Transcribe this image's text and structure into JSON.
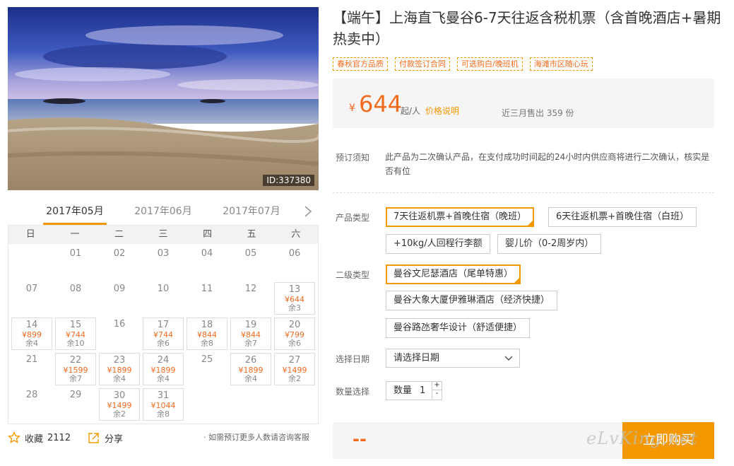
{
  "hero": {
    "id_label": "ID:337380"
  },
  "calendar": {
    "months": [
      "2017年05月",
      "2017年06月",
      "2017年07月"
    ],
    "weekdays": [
      "日",
      "一",
      "二",
      "三",
      "四",
      "五",
      "六"
    ],
    "rows": [
      [
        null,
        {
          "d": "01"
        },
        {
          "d": "02"
        },
        {
          "d": "03"
        },
        {
          "d": "04"
        },
        {
          "d": "05"
        },
        {
          "d": "06"
        }
      ],
      [
        {
          "d": "07"
        },
        {
          "d": "08"
        },
        {
          "d": "09"
        },
        {
          "d": "10"
        },
        {
          "d": "11"
        },
        {
          "d": "12"
        },
        {
          "d": "13",
          "p": "¥644",
          "r": "余3"
        }
      ],
      [
        {
          "d": "14",
          "p": "¥899",
          "r": "余4"
        },
        {
          "d": "15",
          "p": "¥744",
          "r": "余10"
        },
        {
          "d": "16"
        },
        {
          "d": "17",
          "p": "¥744",
          "r": "余6"
        },
        {
          "d": "18",
          "p": "¥844",
          "r": "余8"
        },
        {
          "d": "19",
          "p": "¥844",
          "r": "余7"
        },
        {
          "d": "20",
          "p": "¥799",
          "r": "余6"
        }
      ],
      [
        {
          "d": "21"
        },
        {
          "d": "22",
          "p": "¥1599",
          "r": "余7"
        },
        {
          "d": "23",
          "p": "¥1899",
          "r": "余4"
        },
        {
          "d": "24",
          "p": "¥1899",
          "r": "余4"
        },
        {
          "d": "25"
        },
        {
          "d": "26",
          "p": "¥1899",
          "r": "余4"
        },
        {
          "d": "27",
          "p": "¥1499",
          "r": "余2"
        }
      ],
      [
        {
          "d": "28"
        },
        {
          "d": "29"
        },
        {
          "d": "30",
          "p": "¥1499",
          "r": "余2"
        },
        {
          "d": "31",
          "p": "¥1044",
          "r": "余8"
        },
        null,
        null,
        null
      ]
    ]
  },
  "footer": {
    "fav_label": "收藏",
    "fav_count": "2112",
    "share_label": "分享",
    "consult": "· 如需预订更多人数请咨询客服"
  },
  "product": {
    "title": "【端午】上海直飞曼谷6-7天往返含税机票（含首晚酒店+暑期热卖中）",
    "tags": [
      "春秋官方品质",
      "付款签订合同",
      "可选购白/晚班机",
      "海滩市区随心玩"
    ],
    "currency": "¥",
    "price": "644",
    "per": "起/人",
    "price_note": "价格说明",
    "sold": "近三月售出 359 份"
  },
  "form": {
    "notice_label": "预订须知",
    "notice_text": "此产品为二次确认产品，在支付成功时间起的24小时内供应商将进行二次确认，核实是否有位",
    "type_label": "产品类型",
    "types": [
      "7天往返机票+首晚住宿（晚班）",
      "6天往返机票+首晚住宿（白班）",
      "+10kg/人回程行李额",
      "婴儿价（0-2周岁内）"
    ],
    "subtype_label": "二级类型",
    "subtypes": [
      "曼谷文尼瑟酒店（尾单特惠）",
      "曼谷大象大厦伊雅琳酒店（经济快捷）",
      "曼谷路氹奢华设计（舒适便捷）"
    ],
    "date_label": "选择日期",
    "date_placeholder": "请选择日期",
    "qty_label": "数量选择",
    "qty_text": "数量",
    "qty_value": "1",
    "qty_plus": "+",
    "qty_minus": "-"
  },
  "buy": {
    "total": "--",
    "button": "立即购买",
    "watermark": "eLvKing.net"
  },
  "colors": {
    "accent": "#f39800",
    "price": "#f26b1d"
  }
}
